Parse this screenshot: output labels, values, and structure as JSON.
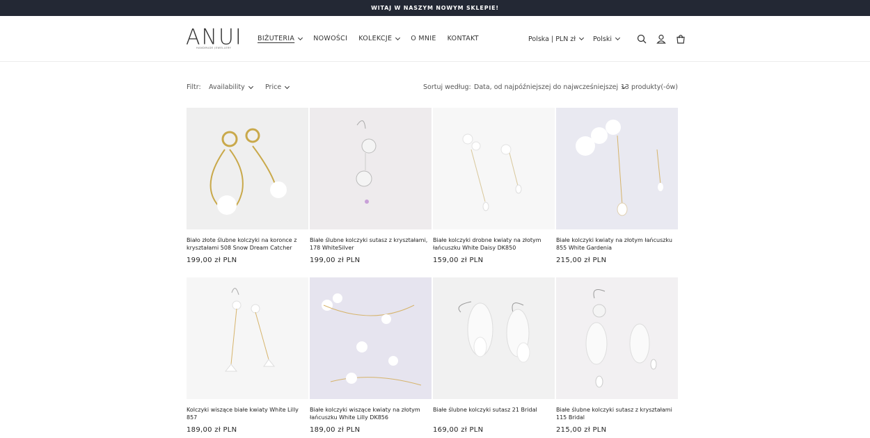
{
  "announcement": "WITAJ W NASZYM NOWYM SKLEPIE!",
  "logo": {
    "word": "ANUI",
    "sub": "HANDMADE JEWELLERY"
  },
  "nav": [
    "BIŻUTERIA",
    "NOWOŚCI",
    "KOLEKCJE",
    "O MNIE",
    "KONTAKT"
  ],
  "header": {
    "currency": "Polska | PLN zł",
    "language": "Polski"
  },
  "filters": {
    "label": "Filtr:",
    "availability": "Availability",
    "price": "Price",
    "sort_label": "Sortuj według:",
    "sort_value": "Data, od najpóźniejszej do najwcześniejszej",
    "count": "13 produkty(-ów)"
  },
  "products": [
    {
      "title": "Biało złote ślubne kolczyki na koronce z kryształami 508 Snow Dream Catcher",
      "price": "199,00 zł PLN",
      "bg": "#efefef"
    },
    {
      "title": "Białe ślubne kolczyki sutasz z kryształami, 178 WhiteSilver",
      "price": "199,00 zł PLN",
      "bg": "#eeebed"
    },
    {
      "title": "Białe kolczyki drobne kwiaty na złotym łańcuszku White Daisy DK850",
      "price": "159,00 zł PLN",
      "bg": "#f7f7f7"
    },
    {
      "title": "Białe kolczyki kwiaty na złotym łańcuszku 855 White Gardenia",
      "price": "215,00 zł PLN",
      "bg": "#e9e9f1"
    },
    {
      "title": "Kolczyki wiszące białe kwiaty White Lilly 857",
      "price": "189,00 zł PLN",
      "bg": "#f6f6f6"
    },
    {
      "title": "Białe kolczyki wiszące kwiaty na złotym łańcuszku White Lilly DK856",
      "price": "189,00 zł PLN",
      "bg": "#e6e4ef"
    },
    {
      "title": "Białe ślubne kolczyki sutasz 21 Bridal",
      "price": "169,00 zł PLN",
      "bg": "#f1f1f1"
    },
    {
      "title": "Białe ślubne kolczyki sutasz z kryształami 115 Bridal",
      "price": "215,00 zł PLN",
      "bg": "#f2f0f2"
    }
  ]
}
